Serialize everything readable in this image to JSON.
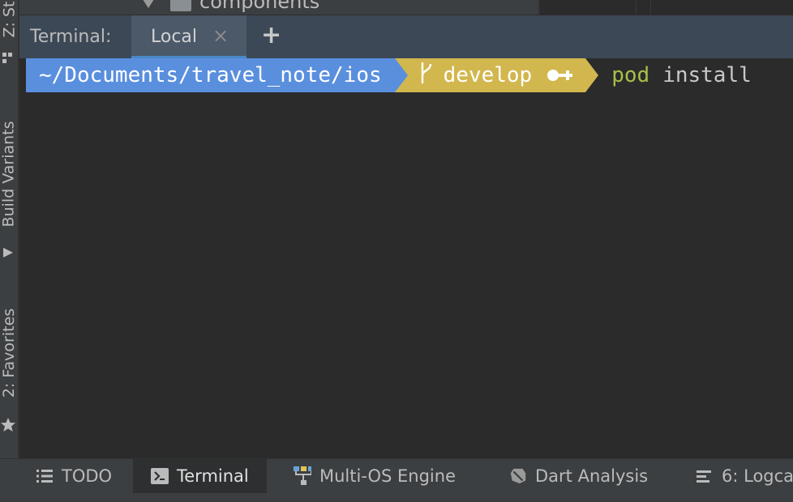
{
  "project_tree": {
    "visible_item": "components"
  },
  "left_strip": {
    "tabs": [
      {
        "label": "Z: St"
      },
      {
        "label": "Build Variants"
      },
      {
        "label": "2: Favorites"
      }
    ]
  },
  "terminal": {
    "title": "Terminal:",
    "tabs": [
      {
        "label": "Local",
        "active": true
      }
    ],
    "close_glyph": "×",
    "add_glyph": "+",
    "prompt": {
      "path": "~/Documents/travel_note/ios",
      "branch": "develop",
      "command": "pod",
      "args": "install"
    }
  },
  "bottom_bar": {
    "tabs": [
      {
        "label": "TODO",
        "icon": "list-icon"
      },
      {
        "label": "Terminal",
        "icon": "terminal-icon",
        "active": true
      },
      {
        "label": "Multi-OS Engine",
        "icon": "multi-os-engine-icon"
      },
      {
        "label": "Dart Analysis",
        "icon": "dart-icon"
      },
      {
        "label": "6: Logca",
        "icon": "logcat-icon"
      }
    ]
  },
  "colors": {
    "path_segment": "#5a8fde",
    "branch_segment": "#d2b74f",
    "command_color": "#a7c04a",
    "active_tab_underline": "#4a88c7"
  }
}
